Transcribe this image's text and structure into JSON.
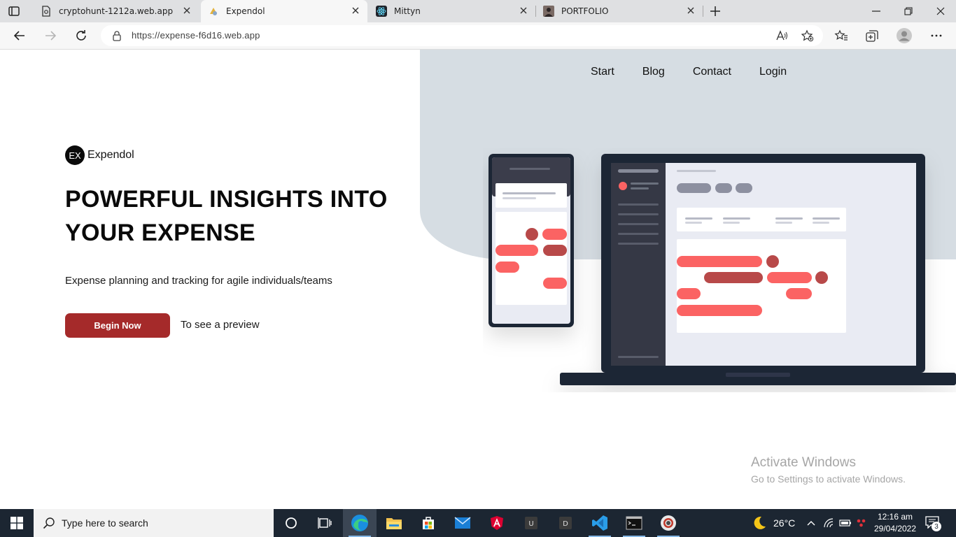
{
  "browser": {
    "tabs": [
      {
        "title": "cryptohunt-1212a.web.app",
        "icon": "document-icon",
        "active": false
      },
      {
        "title": "Expendol",
        "icon": "expendol-favicon",
        "active": true
      },
      {
        "title": "Mittyn",
        "icon": "react-icon",
        "active": false
      },
      {
        "title": "PORTFOLIO",
        "icon": "portrait-icon",
        "active": false
      }
    ],
    "url": "https://expense-f6d16.web.app"
  },
  "page": {
    "nav": [
      "Start",
      "Blog",
      "Contact",
      "Login"
    ],
    "brand": {
      "logo_text": "EX",
      "name": "Expendol"
    },
    "headline": "POWERFUL INSIGHTS INTO YOUR EXPENSE",
    "subtitle": "Expense planning and tracking for agile individuals/teams",
    "cta_label": "Begin Now",
    "preview_label": "To see a preview",
    "colors": {
      "accent": "#a52a2a",
      "hero_bg": "#d6dde3",
      "device_dark": "#1f2536",
      "bubble_red": "#fb6464",
      "bubble_dark_red": "#b84a4a"
    }
  },
  "watermark": {
    "line1": "Activate Windows",
    "line2": "Go to Settings to activate Windows."
  },
  "taskbar": {
    "search_placeholder": "Type here to search",
    "weather": "26°C",
    "time": "12:16 am",
    "date": "29/04/2022",
    "notification_count": "3",
    "apps": [
      "task-view-icon",
      "widgets-icon",
      "edge-icon",
      "file-explorer-icon",
      "store-icon",
      "mail-icon",
      "angular-icon",
      "u-app-icon",
      "d-app-icon",
      "vscode-icon",
      "terminal-icon",
      "chrome-icon"
    ]
  }
}
